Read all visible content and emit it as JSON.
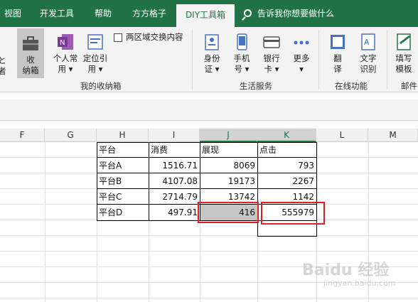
{
  "tabs": [
    {
      "label": "视图",
      "active": false
    },
    {
      "label": "开发工具",
      "active": false
    },
    {
      "label": "帮助",
      "active": false
    },
    {
      "label": "方方格子",
      "active": false
    },
    {
      "label": "DIY工具箱",
      "active": true
    }
  ],
  "tell_me": {
    "placeholder": "告诉我你想要做什么",
    "icon": "search-icon"
  },
  "ribbon": {
    "cut_left": {
      "line1": "と",
      "line2": "者"
    },
    "my_box": {
      "line1": "收",
      "line2": "纳箱"
    },
    "personal": {
      "line1": "个人常",
      "line2": "用 ▾"
    },
    "locate": {
      "line1": "定位引",
      "line2": "用 ▾"
    },
    "swap_checkbox": "两区域交换内容",
    "group_my_box": "我的收纳箱",
    "id_card": {
      "line1": "身份",
      "line2": "证 ▾"
    },
    "phone": {
      "line1": "手机",
      "line2": "号 ▾"
    },
    "bank": {
      "line1": "银行",
      "line2": "卡 ▾"
    },
    "more": {
      "line1": "更多",
      "line2": "▾"
    },
    "group_life": "生活服务",
    "translate": {
      "line1": "翻",
      "line2": "译"
    },
    "ocr": {
      "line1": "文字",
      "line2": "识别"
    },
    "group_online": "在线功能",
    "fill_template": {
      "line1": "填写",
      "line2": "模板"
    },
    "group_mail": "邮件",
    "colors": {
      "ribbon_green": "#217346",
      "highlight_red": "#e02020",
      "selected_cell": "#c6c6c6"
    }
  },
  "columns": [
    "F",
    "G",
    "H",
    "I",
    "J",
    "K",
    "L",
    "M"
  ],
  "table": {
    "headers": [
      "平台",
      "消费",
      "展现",
      "点击"
    ],
    "rows": [
      [
        "平台A",
        "1516.71",
        "8069",
        "793"
      ],
      [
        "平台B",
        "4107.08",
        "19173",
        "2267"
      ],
      [
        "平台C",
        "2714.79",
        "13742",
        "1142"
      ],
      [
        "平台D",
        "497.91",
        "416",
        "555979"
      ]
    ]
  },
  "watermark": {
    "main": "Baidu 经验",
    "sub": "jingyan.baidu.com"
  }
}
